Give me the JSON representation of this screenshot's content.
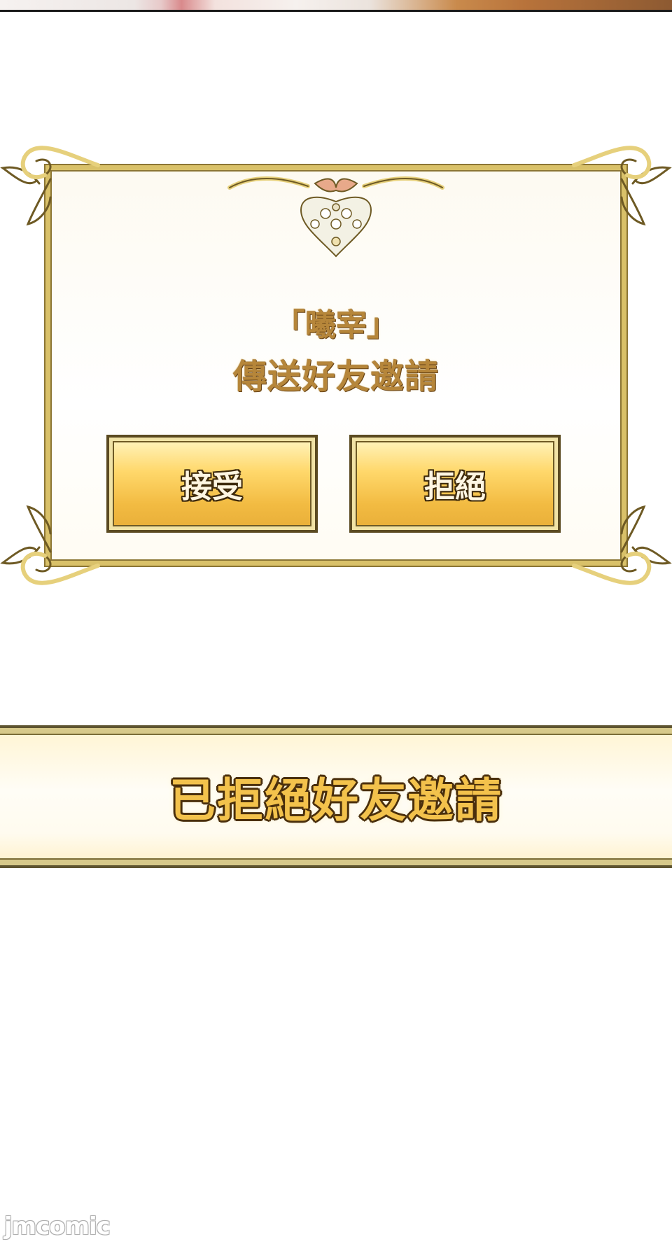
{
  "dialog": {
    "requester_name": "「曦宰」",
    "message": "傳送好友邀請",
    "accept_label": "接受",
    "reject_label": "拒絕"
  },
  "notification": {
    "text": "已拒絕好友邀請"
  },
  "watermark": {
    "text": "jmcomic"
  },
  "colors": {
    "frame_gold": "#d9c169",
    "frame_outline": "#8b7534",
    "button_gold": "#f2bb42",
    "title_text": "#b6863a",
    "banner_text": "#f3c24c"
  },
  "icons": {
    "crest": "floral-crest-icon"
  }
}
